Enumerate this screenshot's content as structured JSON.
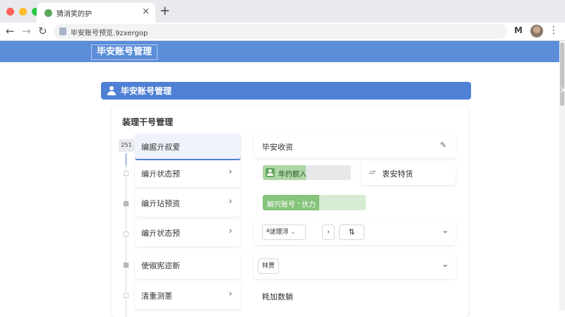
{
  "browser": {
    "tab_title": "猜消笑的护",
    "tab_close": "×",
    "new_tab": "+",
    "back": "←",
    "forward": "→",
    "reload": "↻",
    "url": "毕安账号预览.9zxergop",
    "ext_label": "M",
    "menu": "⋮",
    "colors": {
      "red": "#ff5f57",
      "yellow": "#febc2e",
      "green": "#28c840"
    }
  },
  "app": {
    "title": "毕安账号管理",
    "accent": "#4f80d4"
  },
  "panel": {
    "title": "毕安账号管理",
    "search_icon": "⌕",
    "move_icon": "✥",
    "close_icon": "✕"
  },
  "card": {
    "title": "装理干号管理",
    "badge": "251",
    "rows": [
      {
        "label": "编掘亓叔爱",
        "chevron": ""
      },
      {
        "label": "编亓状态预",
        "chevron": "›"
      },
      {
        "label": "编亓玷预资",
        "chevron": "›"
      },
      {
        "label": "编亓状态预",
        "chevron": "›"
      },
      {
        "label": "使俶宪迩新",
        "chevron": ""
      },
      {
        "label": "清重测蔥",
        "chevron": "›"
      }
    ],
    "right": {
      "title": "毕安收资",
      "edit_icon": "✎",
      "progress1_label": "年约额入",
      "progress1_fraction": 0.49,
      "secondary_label": "衷安特赁",
      "progress2_label": "解宍账号 ' 㐲力",
      "progress2_fraction": 0.55,
      "select_value": "ª谜理浔",
      "select_caret": "⌄",
      "chev_right": "›",
      "swap_icon": "⇅",
      "dropdown_icon": "⌄",
      "tag": "林贾",
      "footer": "粍加数躺"
    }
  }
}
